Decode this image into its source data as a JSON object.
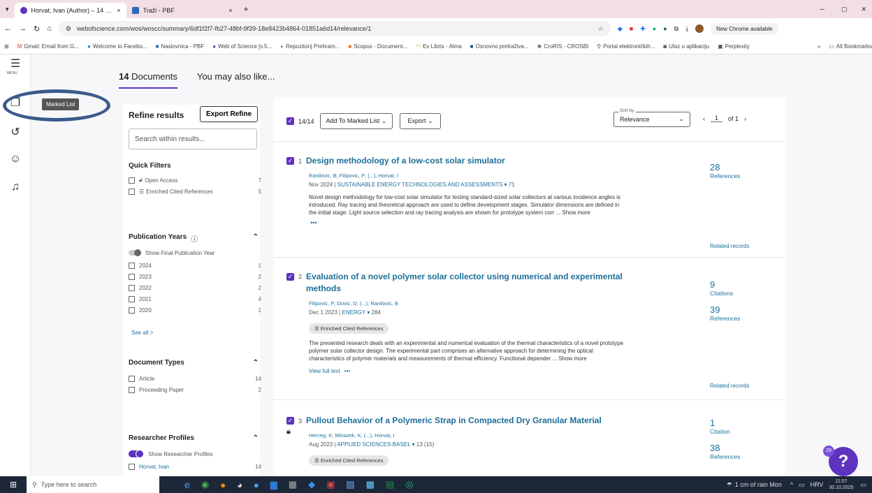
{
  "browser": {
    "tabs": [
      {
        "title": "Horvat, Ivan (Author) – 14 – Web of Science",
        "close": "×"
      },
      {
        "title": "Traži - PBF",
        "close": "×"
      }
    ],
    "new_tab": "+",
    "url": "webofscience.com/wos/woscc/summary/6df1f2f7-fb27-48bf-9f39-18e8423b4864-01851a6d14/relevance/1",
    "update_notice": "New Chrome available",
    "bookmarks": [
      "Gmail: Email from G...",
      "Welcome to Facebo...",
      "Naslovnica - PBF",
      "Web of Science [v.5...",
      "Repozitorij Prehram...",
      "Scopus - Document...",
      "Ex Libris - Alma",
      "Osnovno pretraživa...",
      "CroRIS - CROSBI",
      "Portal elektroničkih...",
      "Ulaz u aplikaciju",
      "Perplexity"
    ],
    "all_bookmarks": "All Bookmarks"
  },
  "rail": {
    "menu_label": "MENU",
    "tooltip": "Marked List"
  },
  "tabs": {
    "documents_count": "14",
    "documents_label": "Documents",
    "also_like": "You may also like..."
  },
  "refine": {
    "title": "Refine results",
    "export_button": "Export Refine",
    "search_placeholder": "Search within results...",
    "quick_filters": "Quick Filters",
    "qf_items": [
      {
        "label": "Open Access",
        "count": "7"
      },
      {
        "label": "Enriched Cited References",
        "count": "5"
      }
    ],
    "pub_years": "Publication Years",
    "show_final": "Show Final Publication Year",
    "years": [
      {
        "label": "2024",
        "count": "1"
      },
      {
        "label": "2023",
        "count": "2"
      },
      {
        "label": "2022",
        "count": "2"
      },
      {
        "label": "2021",
        "count": "4"
      },
      {
        "label": "2020",
        "count": "1"
      }
    ],
    "see_all": "See all >",
    "doc_types": "Document Types",
    "doc_items": [
      {
        "label": "Article",
        "count": "14"
      },
      {
        "label": "Proceeding Paper",
        "count": "2"
      }
    ],
    "researcher_profiles": "Researcher Profiles",
    "show_researcher": "Show Researcher Profiles",
    "researcher_items": [
      {
        "label": "Horvat, Ivan",
        "count": "14"
      }
    ]
  },
  "results": {
    "selected": "14/14",
    "add_marked": "Add To Marked List",
    "export": "Export",
    "sort_label": "Sort by",
    "sort_value": "Relevance",
    "page": "1",
    "of_pages": "of 1",
    "records": [
      {
        "num": "1",
        "title_lines": [
          "Design methodology of a low-cost solar simulator"
        ],
        "authors": "Ranilovic, B; Filipovic, P; (...); Horvat, I",
        "date": "Nov 2024 |",
        "journal": "SUSTAINABLE ENERGY TECHNOLOGIES AND ASSESSMENTS",
        "vol": "71",
        "abstract": [
          "Novel design methodology for low-cost solar simulator for testing standard-sized solar collectors at various incidence angles is",
          "introduced. Ray tracing and theoretical approach are used to define development stages. Simulator dimensions are defined in",
          "the initial stage. Light source selection and ray tracing analysis are shown for prototype system corr ...  Show more"
        ],
        "metrics": [
          {
            "n": "28",
            "label": "References"
          }
        ],
        "related": "Related records",
        "more": "•••"
      },
      {
        "num": "2",
        "title_lines": [
          "Evaluation of a novel polymer solar collector using numerical and experimental",
          "methods"
        ],
        "authors": "Filipovic, P; Dovic, D; (...); Ranilovic, B",
        "date": "Dec 1 2023 |",
        "journal": "ENERGY",
        "vol": "284",
        "badge": "Enriched Cited References",
        "abstract": [
          "The presented research deals with an experimental and numerical evaluation of the thermal characteristics of a novel prototype",
          "polymer solar collector design. The experimental part comprises an alternative approach for determining the optical",
          "characteristics of polymer materials and measurements of thermal efficiency. Functional depender ...  Show more"
        ],
        "metrics": [
          {
            "n": "9",
            "label": "Citations"
          },
          {
            "n": "39",
            "label": "References"
          }
        ],
        "full_text": "View full text",
        "related": "Related records",
        "more": "•••"
      },
      {
        "num": "3",
        "title_lines": [
          "Pullout Behavior of a Polymeric Strap in Compacted Dry Granular Material"
        ],
        "authors": "Herceg, K; Minazek, K; (...); Horvat, I",
        "date": "Aug 2023 |",
        "journal": "APPLIED SCIENCES-BASEL",
        "vol": "13 (15)",
        "badge": "Enriched Cited References",
        "metrics": [
          {
            "n": "1",
            "label": "Citation"
          },
          {
            "n": "38",
            "label": "References"
          }
        ]
      }
    ]
  },
  "help": {
    "badge": "29",
    "icon": "?"
  },
  "taskbar": {
    "search": "Type here to search",
    "weather": "1 cm of rain Mon",
    "lang": "HRV",
    "time": "11:57",
    "date": "30.10.2025"
  }
}
